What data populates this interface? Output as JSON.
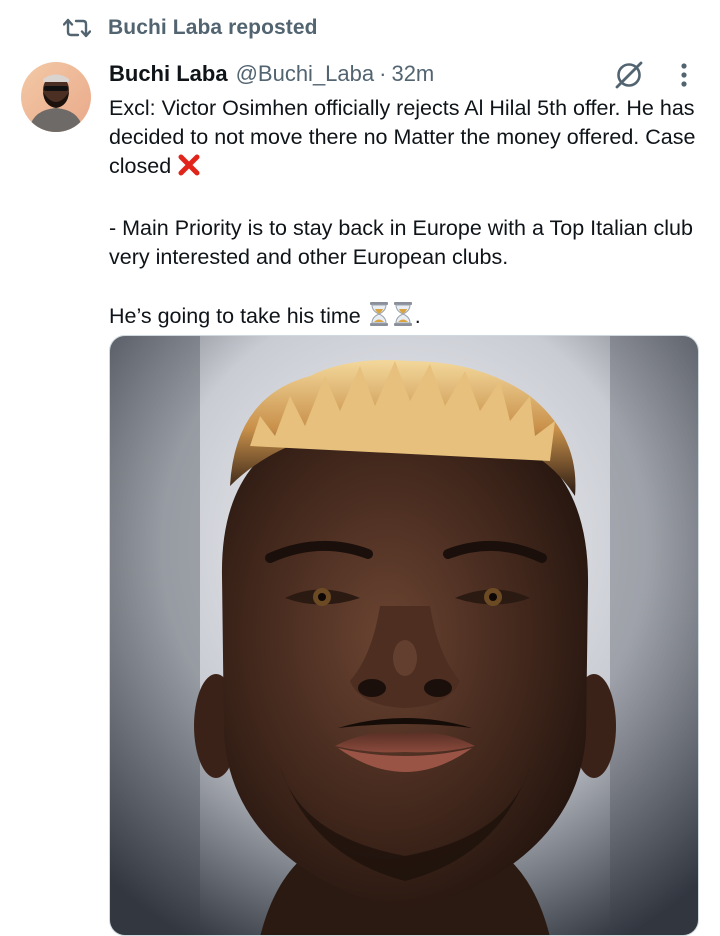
{
  "repost": {
    "icon": "repost-icon",
    "text": "Buchi Laba reposted"
  },
  "tweet": {
    "author": {
      "name": "Buchi Laba",
      "handle": "@Buchi_Laba",
      "avatar_icon": "avatar"
    },
    "separator": "·",
    "time": "32m",
    "actions": {
      "grok_icon": "grok-icon",
      "more_icon": "more-icon"
    },
    "paragraphs": [
      {
        "text": "Excl: Victor Osimhen officially rejects Al Hilal 5th offer. He has decided to not move there no Matter the money offered. Case closed ",
        "emoji": "cross-mark"
      },
      {
        "text": "- Main Priority is to stay back in Europe with a Top Italian club very interested and other European clubs."
      },
      {
        "text": "He’s going to take his time ",
        "emoji": "hourglass",
        "suffix": "."
      }
    ],
    "media": {
      "type": "photo",
      "subject": "footballer-portrait"
    }
  },
  "colors": {
    "text": "#0f1419",
    "secondary": "#536471",
    "cross": "#e1251b",
    "hourglass_sand": "#d9a441"
  }
}
